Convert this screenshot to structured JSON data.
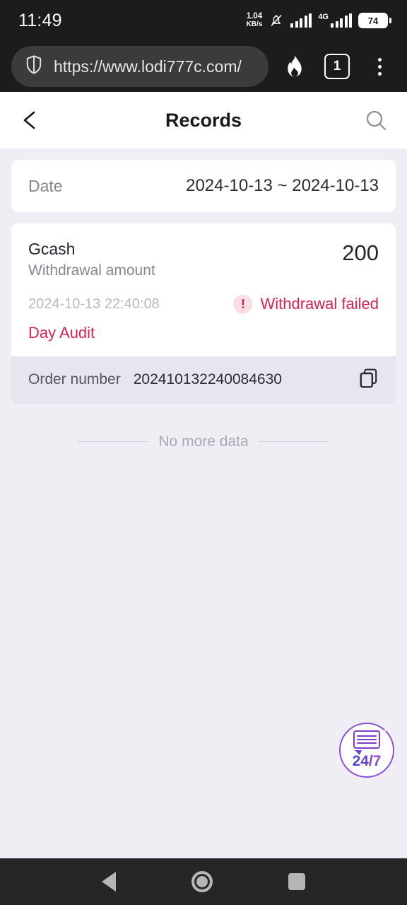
{
  "status_bar": {
    "clock": "11:49",
    "net_speed_value": "1.04",
    "net_speed_unit": "KB/s",
    "mute_icon": "bell-muted-icon",
    "signal_icon": "signal-bars-icon",
    "network_type": "4G",
    "battery_level": "74"
  },
  "browser": {
    "shield_icon": "shield-icon",
    "url": "https://www.lodi777c.com/",
    "turbo_icon": "flame-icon",
    "tab_count": "1",
    "menu_icon": "three-dots-menu-icon"
  },
  "app_bar": {
    "back_icon": "chevron-left-icon",
    "title": "Records",
    "search_icon": "search-icon"
  },
  "date_filter": {
    "label": "Date",
    "value": "2024-10-13 ~ 2024-10-13"
  },
  "record": {
    "method": "Gcash",
    "type": "Withdrawal amount",
    "amount": "200",
    "timestamp": "2024-10-13 22:40:08",
    "status": "Withdrawal failed",
    "status_icon": "alert-exclamation-icon",
    "status_color": "#d7234f",
    "audit_link": "Day Audit",
    "order_label": "Order number",
    "order_number": "202410132240084630",
    "copy_icon": "copy-icon"
  },
  "list_footer": {
    "text": "No more data"
  },
  "support_widget": {
    "label": "24/7",
    "chat_icon": "chat-bubble-icon",
    "close_icon": "close-icon"
  },
  "nav_bar": {
    "back_icon": "triangle-back-icon",
    "home_icon": "circle-home-icon",
    "recents_icon": "square-recents-icon"
  }
}
